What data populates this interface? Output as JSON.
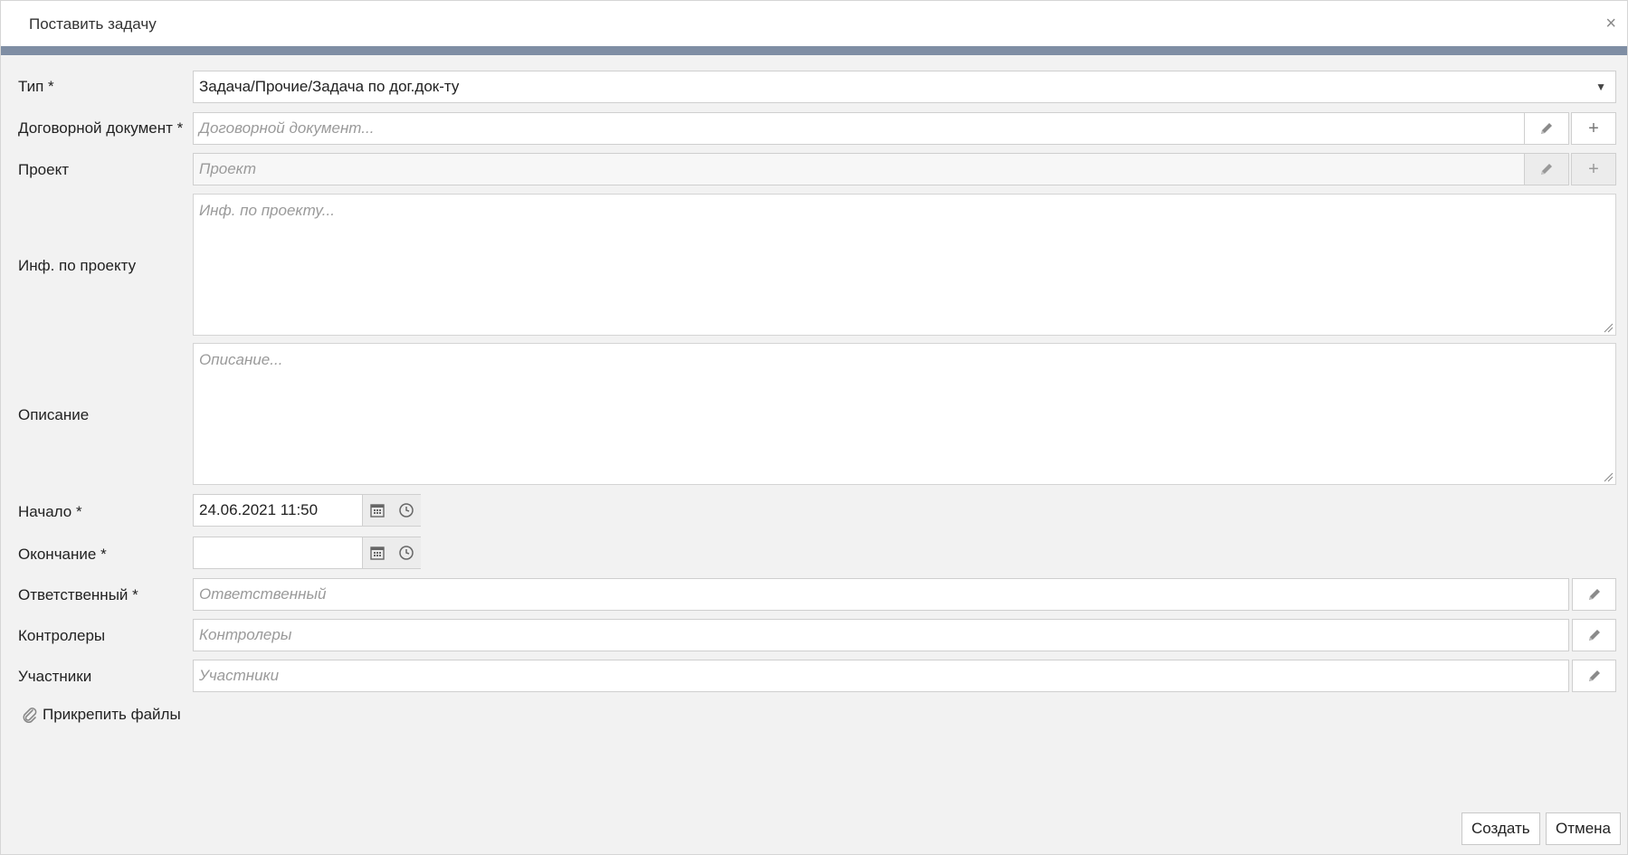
{
  "dialog": {
    "title": "Поставить задачу",
    "close_symbol": "×"
  },
  "form": {
    "type": {
      "label": "Тип *",
      "value": "Задача/Прочие/Задача по дог.док-ту",
      "arrow": "▼"
    },
    "contract_doc": {
      "label": "Договорной документ *",
      "placeholder": "Договорной документ...",
      "edit_icon": "pencil-icon",
      "add_symbol": "+"
    },
    "project": {
      "label": "Проект",
      "placeholder": "Проект",
      "edit_icon": "pencil-icon",
      "add_symbol": "+"
    },
    "project_info": {
      "label": "Инф. по проекту",
      "placeholder": "Инф. по проекту..."
    },
    "description": {
      "label": "Описание",
      "placeholder": "Описание..."
    },
    "start": {
      "label": "Начало *",
      "value": "24.06.2021 11:50"
    },
    "end": {
      "label": "Окончание *",
      "value": ""
    },
    "responsible": {
      "label": "Ответственный *",
      "placeholder": "Ответственный"
    },
    "controllers": {
      "label": "Контролеры",
      "placeholder": "Контролеры"
    },
    "participants": {
      "label": "Участники",
      "placeholder": "Участники"
    },
    "attach_files": "Прикрепить файлы"
  },
  "footer": {
    "create_label": "Создать",
    "cancel_label": "Отмена"
  },
  "colors": {
    "header_stripe": "#7f8ea4",
    "background": "#f2f2f2"
  }
}
